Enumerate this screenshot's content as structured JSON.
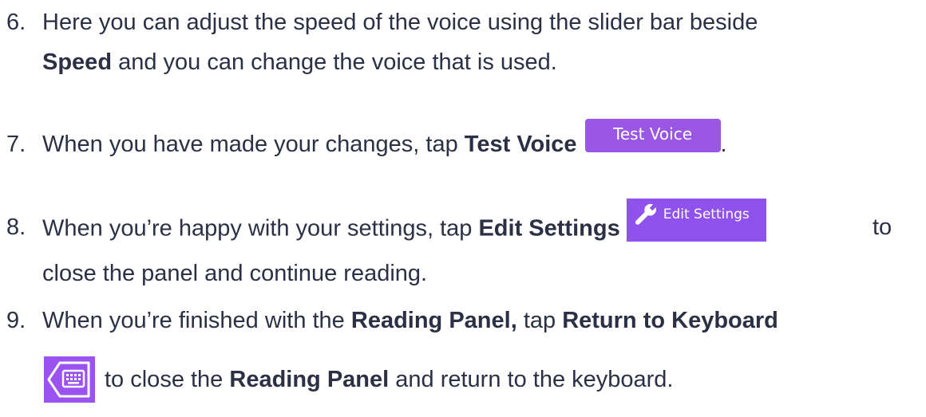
{
  "steps": [
    {
      "number": "6.",
      "line1": "Here you can adjust the speed of the voice using the slider bar beside",
      "line2_bold": "Speed",
      "line2_rest": " and you can change the voice that is used."
    },
    {
      "number": "7.",
      "text_before": "When you have made your changes, tap ",
      "bold": "Test Voice",
      "button_label": "Test Voice",
      "text_after": "."
    },
    {
      "number": "8.",
      "text_before": "When you’re happy with your settings, tap ",
      "bold": "Edit Settings",
      "button_label": "Edit Settings",
      "text_after": "to",
      "line2": "close the panel and continue reading."
    },
    {
      "number": "9.",
      "text_before": "When you’re finished with the ",
      "bold1": "Reading Panel,",
      "text_mid": " tap ",
      "bold2": "Return to Keyboard",
      "line2_before": "to close the ",
      "line2_bold": "Reading Panel",
      "line2_after": " and return to the keyboard."
    }
  ],
  "icons": {
    "edit_settings": "wrench-icon",
    "return_to_keyboard": "keyboard-return-icon"
  },
  "colors": {
    "text": "#2b3044",
    "button_purple": "#9a57e3",
    "button_text": "#ffffff"
  }
}
